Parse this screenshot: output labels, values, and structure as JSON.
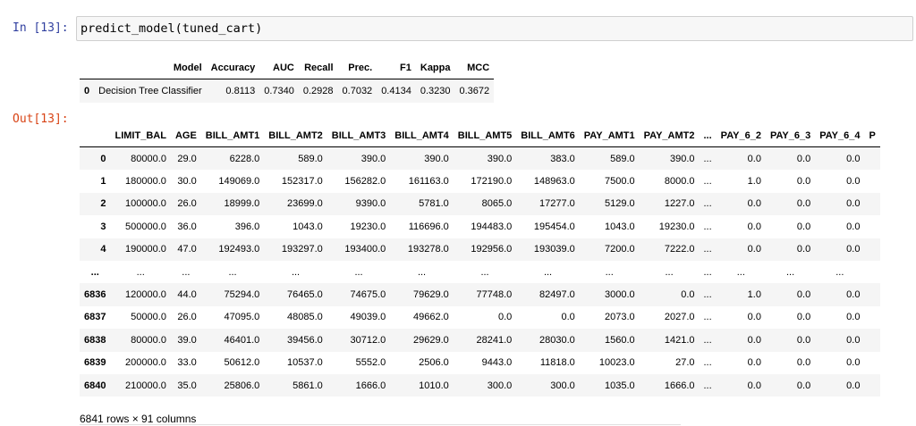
{
  "cell": {
    "in_prompt": "In [13]:",
    "code": "predict_model(tuned_cart)",
    "out_prompt": "Out[13]:"
  },
  "metrics_table": {
    "headers": [
      "",
      "Model",
      "Accuracy",
      "AUC",
      "Recall",
      "Prec.",
      "F1",
      "Kappa",
      "MCC"
    ],
    "rows": [
      [
        "0",
        "Decision Tree Classifier",
        "0.8113",
        "0.7340",
        "0.2928",
        "0.7032",
        "0.4134",
        "0.3230",
        "0.3672"
      ]
    ]
  },
  "data_table": {
    "headers": [
      "",
      "LIMIT_BAL",
      "AGE",
      "BILL_AMT1",
      "BILL_AMT2",
      "BILL_AMT3",
      "BILL_AMT4",
      "BILL_AMT5",
      "BILL_AMT6",
      "PAY_AMT1",
      "PAY_AMT2",
      "...",
      "PAY_6_2",
      "PAY_6_3",
      "PAY_6_4",
      "P"
    ],
    "rows": [
      [
        "0",
        "80000.0",
        "29.0",
        "6228.0",
        "589.0",
        "390.0",
        "390.0",
        "390.0",
        "383.0",
        "589.0",
        "390.0",
        "...",
        "0.0",
        "0.0",
        "0.0",
        ""
      ],
      [
        "1",
        "180000.0",
        "30.0",
        "149069.0",
        "152317.0",
        "156282.0",
        "161163.0",
        "172190.0",
        "148963.0",
        "7500.0",
        "8000.0",
        "...",
        "1.0",
        "0.0",
        "0.0",
        ""
      ],
      [
        "2",
        "100000.0",
        "26.0",
        "18999.0",
        "23699.0",
        "9390.0",
        "5781.0",
        "8065.0",
        "17277.0",
        "5129.0",
        "1227.0",
        "...",
        "0.0",
        "0.0",
        "0.0",
        ""
      ],
      [
        "3",
        "500000.0",
        "36.0",
        "396.0",
        "1043.0",
        "19230.0",
        "116696.0",
        "194483.0",
        "195454.0",
        "1043.0",
        "19230.0",
        "...",
        "0.0",
        "0.0",
        "0.0",
        ""
      ],
      [
        "4",
        "190000.0",
        "47.0",
        "192493.0",
        "193297.0",
        "193400.0",
        "193278.0",
        "192956.0",
        "193039.0",
        "7200.0",
        "7222.0",
        "...",
        "0.0",
        "0.0",
        "0.0",
        ""
      ],
      [
        "...",
        "...",
        "...",
        "...",
        "...",
        "...",
        "...",
        "...",
        "...",
        "...",
        "...",
        "...",
        "...",
        "...",
        "...",
        ""
      ],
      [
        "6836",
        "120000.0",
        "44.0",
        "75294.0",
        "76465.0",
        "74675.0",
        "79629.0",
        "77748.0",
        "82497.0",
        "3000.0",
        "0.0",
        "...",
        "1.0",
        "0.0",
        "0.0",
        ""
      ],
      [
        "6837",
        "50000.0",
        "26.0",
        "47095.0",
        "48085.0",
        "49039.0",
        "49662.0",
        "0.0",
        "0.0",
        "2073.0",
        "2027.0",
        "...",
        "0.0",
        "0.0",
        "0.0",
        ""
      ],
      [
        "6838",
        "80000.0",
        "39.0",
        "46401.0",
        "39456.0",
        "30712.0",
        "29629.0",
        "28241.0",
        "28030.0",
        "1560.0",
        "1421.0",
        "...",
        "0.0",
        "0.0",
        "0.0",
        ""
      ],
      [
        "6839",
        "200000.0",
        "33.0",
        "50612.0",
        "10537.0",
        "5552.0",
        "2506.0",
        "9443.0",
        "11818.0",
        "10023.0",
        "27.0",
        "...",
        "0.0",
        "0.0",
        "0.0",
        ""
      ],
      [
        "6840",
        "210000.0",
        "35.0",
        "25806.0",
        "5861.0",
        "1666.0",
        "1010.0",
        "300.0",
        "300.0",
        "1035.0",
        "1666.0",
        "...",
        "0.0",
        "0.0",
        "0.0",
        ""
      ]
    ],
    "footer": "6841 rows × 91 columns"
  }
}
